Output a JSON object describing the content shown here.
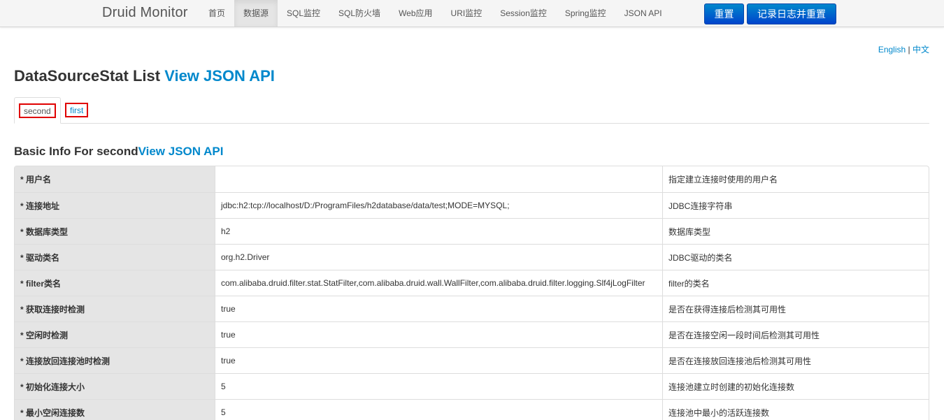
{
  "navbar": {
    "brand": "Druid Monitor",
    "items": [
      {
        "label": "首页"
      },
      {
        "label": "数据源"
      },
      {
        "label": "SQL监控"
      },
      {
        "label": "SQL防火墙"
      },
      {
        "label": "Web应用"
      },
      {
        "label": "URI监控"
      },
      {
        "label": "Session监控"
      },
      {
        "label": "Spring监控"
      },
      {
        "label": "JSON API"
      }
    ],
    "active": "数据源",
    "reset_label": "重置",
    "log_reset_label": "记录日志并重置"
  },
  "lang": {
    "english": "English",
    "separator": "|",
    "chinese": "中文"
  },
  "page": {
    "title": "DataSourceStat List",
    "api_link": "View JSON API"
  },
  "tabs": [
    {
      "label": "second",
      "active": true
    },
    {
      "label": "first",
      "active": false
    }
  ],
  "section": {
    "title": "Basic Info For second",
    "api_link": "View JSON API"
  },
  "rows": [
    {
      "name": "* 用户名",
      "value": "",
      "desc": "指定建立连接时使用的用户名"
    },
    {
      "name": "* 连接地址",
      "value": "jdbc:h2:tcp://localhost/D:/ProgramFiles/h2database/data/test;MODE=MYSQL;",
      "desc": "JDBC连接字符串"
    },
    {
      "name": "* 数据库类型",
      "value": "h2",
      "desc": "数据库类型"
    },
    {
      "name": "* 驱动类名",
      "value": "org.h2.Driver",
      "desc": "JDBC驱动的类名"
    },
    {
      "name": "* filter类名",
      "value": "com.alibaba.druid.filter.stat.StatFilter,com.alibaba.druid.wall.WallFilter,com.alibaba.druid.filter.logging.Slf4jLogFilter",
      "desc": "filter的类名"
    },
    {
      "name": "* 获取连接时检测",
      "value": "true",
      "desc": "是否在获得连接后检测其可用性"
    },
    {
      "name": "* 空闲时检测",
      "value": "true",
      "desc": "是否在连接空闲一段时间后检测其可用性"
    },
    {
      "name": "* 连接放回连接池时检测",
      "value": "true",
      "desc": "是否在连接放回连接池后检测其可用性"
    },
    {
      "name": "* 初始化连接大小",
      "value": "5",
      "desc": "连接池建立时创建的初始化连接数"
    },
    {
      "name": "* 最小空闲连接数",
      "value": "5",
      "desc": "连接池中最小的活跃连接数"
    }
  ],
  "colors": {
    "link": "#0088cc",
    "button_top": "#0088cc",
    "button_bottom": "#0044cc",
    "highlight": "#e00000",
    "label_bg": "#e5e5e5"
  }
}
